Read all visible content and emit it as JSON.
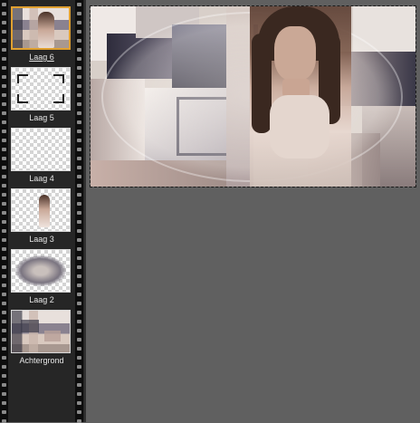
{
  "layers_panel": {
    "layers": [
      {
        "label": "Laag 6",
        "selected": true,
        "thumb": "collage-with-portrait"
      },
      {
        "label": "Laag 5",
        "selected": false,
        "thumb": "frame-brackets"
      },
      {
        "label": "Laag 4",
        "selected": false,
        "thumb": "transparent"
      },
      {
        "label": "Laag 3",
        "selected": false,
        "thumb": "portrait-on-transparent"
      },
      {
        "label": "Laag 2",
        "selected": false,
        "thumb": "blurred-oval"
      },
      {
        "label": "Achtergrond",
        "selected": false,
        "thumb": "collage"
      }
    ]
  },
  "colors": {
    "workspace": "#606060",
    "panel": "#262626",
    "film_strip": "#0d0d0d",
    "selection": "#e0a030",
    "label_text": "#e6e6e6"
  }
}
